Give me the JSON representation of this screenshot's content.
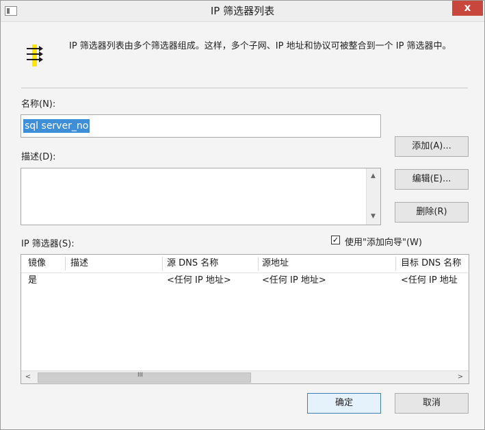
{
  "window": {
    "title": "IP 筛选器列表",
    "close_label": "x"
  },
  "intro": {
    "text": "IP 筛选器列表由多个筛选器组成。这样，多个子网、IP 地址和协议可被整合到一个 IP 筛选器中。"
  },
  "form": {
    "name_label": "名称(N):",
    "name_value": "sql server_no",
    "description_label": "描述(D):",
    "description_value": "",
    "filters_label": "IP 筛选器(S):",
    "wizard_label": "使用\"添加向导\"(W)",
    "wizard_checked": true
  },
  "buttons": {
    "add": "添加(A)...",
    "edit": "编辑(E)...",
    "delete": "删除(R)",
    "ok": "确定",
    "cancel": "取消"
  },
  "filters_table": {
    "columns": [
      "镜像",
      "描述",
      "源 DNS 名称",
      "源地址",
      "目标 DNS 名称"
    ],
    "rows": [
      [
        "是",
        "",
        "<任何 IP 地址>",
        "<任何 IP 地址>",
        "<任何 IP 地址"
      ]
    ]
  },
  "icons": {
    "header": "filter-list-icon",
    "system": "window-icon",
    "scroll_up": "scroll-up-icon",
    "scroll_down": "scroll-down-icon",
    "scroll_left": "scroll-left-icon",
    "scroll_right": "scroll-right-icon",
    "scroll_grip": "III"
  },
  "colors": {
    "selection": "#3f8ed8",
    "close": "#c9463d",
    "primary_border": "#3c7fb1"
  }
}
